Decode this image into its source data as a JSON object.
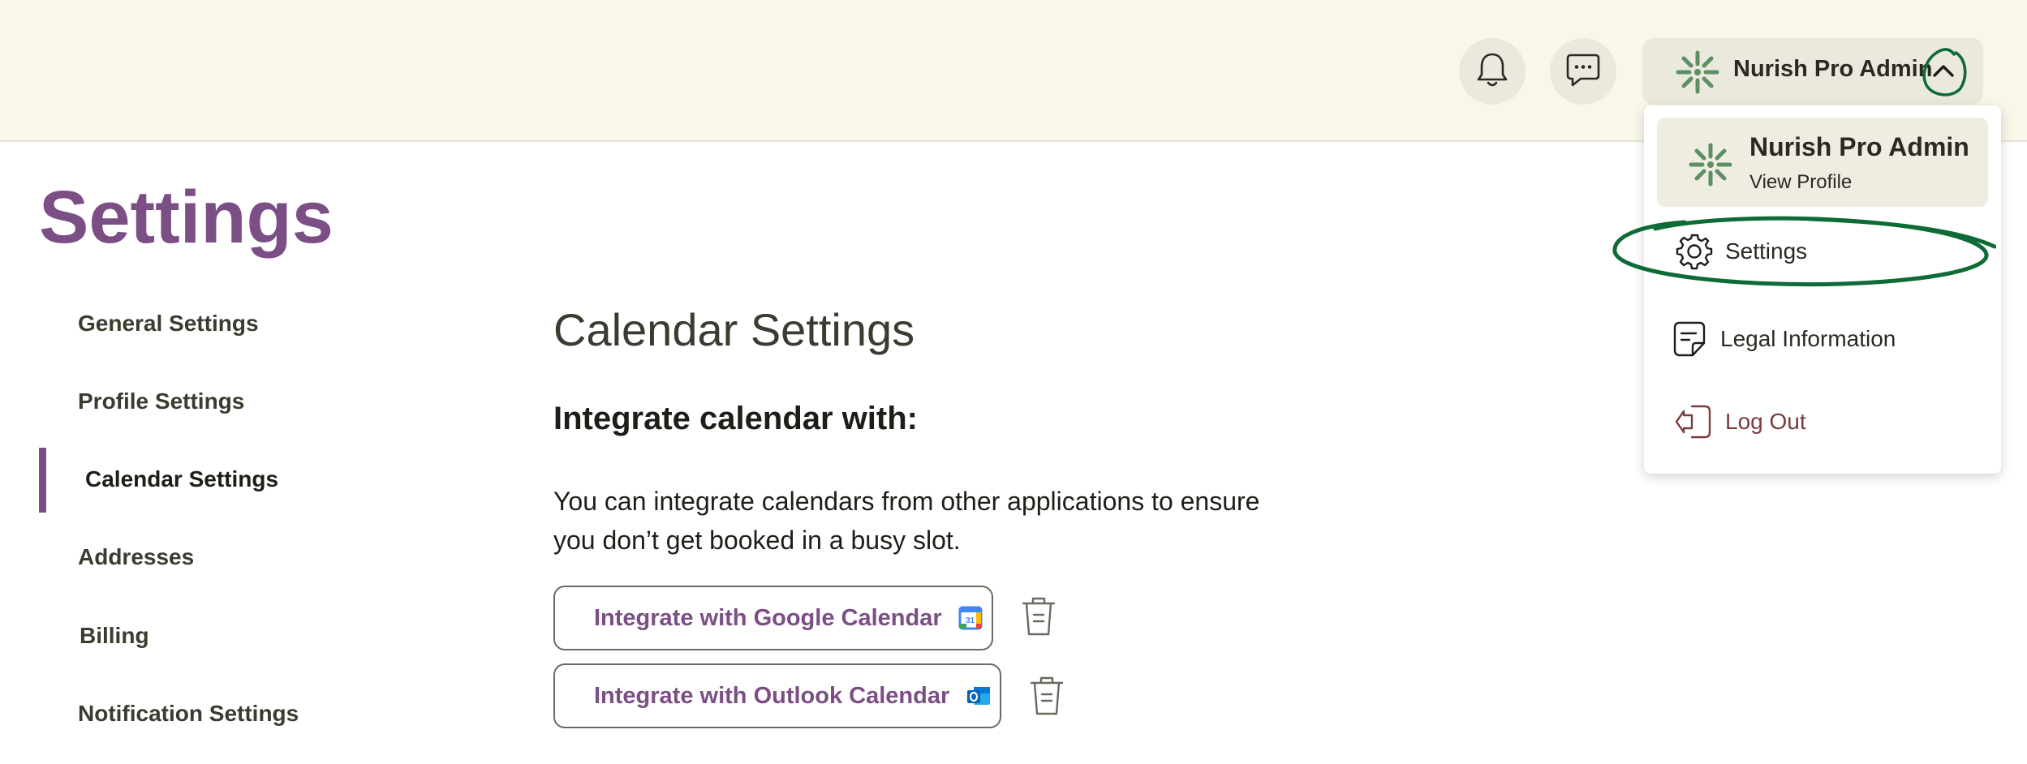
{
  "header": {
    "notifications_icon": "bell-icon",
    "messages_icon": "chat-bubble-icon",
    "profile": {
      "name": "Nurish Pro Admin",
      "toggle_icon": "chevron-up-icon",
      "logo_icon": "nurish-logo-icon"
    }
  },
  "dropdown": {
    "profile_name": "Nurish Pro Admin",
    "profile_link": "View Profile",
    "items": [
      {
        "label": "Settings",
        "icon": "gear-icon"
      },
      {
        "label": "Legal Information",
        "icon": "document-icon"
      },
      {
        "label": "Log Out",
        "icon": "logout-icon"
      }
    ]
  },
  "page": {
    "title": "Settings"
  },
  "sidebar": {
    "items": [
      {
        "label": "General Settings"
      },
      {
        "label": "Profile Settings"
      },
      {
        "label": "Calendar Settings",
        "active": true
      },
      {
        "label": "Addresses"
      },
      {
        "label": "Billing"
      },
      {
        "label": "Notification Settings"
      }
    ]
  },
  "main": {
    "section_title": "Calendar Settings",
    "subtitle": "Integrate calendar with:",
    "description": "You can integrate calendars from other applications to ensure you don’t get booked in a busy slot.",
    "integrations": [
      {
        "label": "Integrate with Google Calendar",
        "icon": "google-calendar-icon",
        "delete_icon": "trash-icon"
      },
      {
        "label": "Integrate with Outlook Calendar",
        "icon": "outlook-icon",
        "delete_icon": "trash-icon"
      }
    ]
  },
  "colors": {
    "accent": "#7b4f85",
    "header_bg": "#f9f7ea",
    "logo_green": "#5c8f63",
    "annotation_green": "#0f6b36",
    "logout": "#7a3b3b"
  }
}
